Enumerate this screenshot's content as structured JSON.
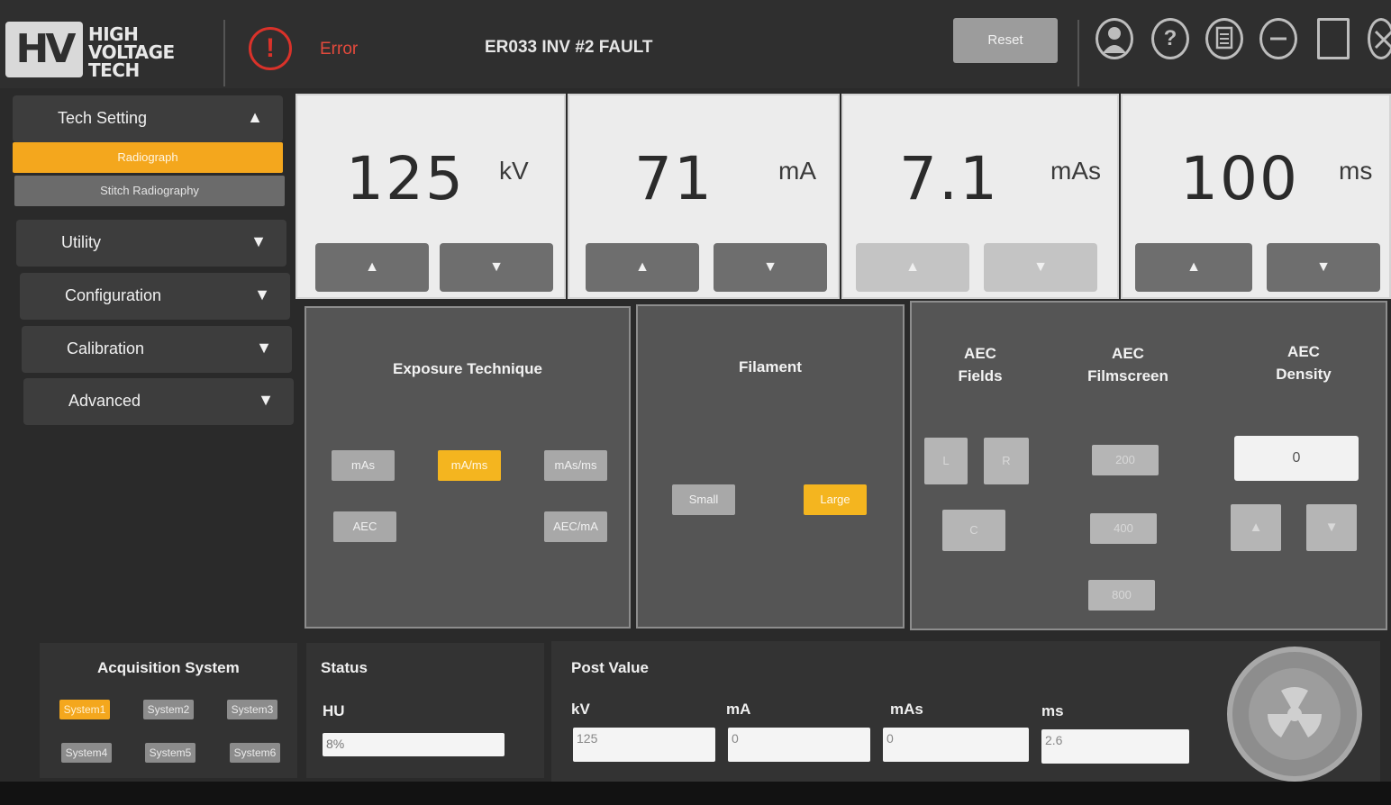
{
  "header": {
    "logo_mark": "HV",
    "logo_lines": [
      "HIGH",
      "VOLTAGE",
      "TECH"
    ],
    "error_icon": "!",
    "error_label": "Error",
    "error_message": "ER033 INV #2 FAULT",
    "reset_label": "Reset",
    "icons": [
      "user-icon",
      "help-icon",
      "document-icon",
      "minimize-icon",
      "maximize-icon",
      "close-icon"
    ]
  },
  "sidebar": {
    "tech_setting": {
      "label": "Tech Setting",
      "arrow": "▲"
    },
    "sub_items": [
      {
        "label": "Radiograph",
        "active": true
      },
      {
        "label": "Stitch Radiography",
        "active": false
      }
    ],
    "menus": [
      {
        "label": "Utility",
        "arrow": "▼"
      },
      {
        "label": "Configuration",
        "arrow": "▼"
      },
      {
        "label": "Calibration",
        "arrow": "▼"
      },
      {
        "label": "Advanced",
        "arrow": "▼"
      }
    ]
  },
  "technique": {
    "kv": {
      "value": "125",
      "unit": "kV"
    },
    "ma": {
      "value": "71",
      "unit": "mA"
    },
    "mas": {
      "value": "7.1",
      "unit": "mAs"
    },
    "ms": {
      "value": "100",
      "unit": "ms"
    },
    "up_glyph": "▲",
    "down_glyph": "▼"
  },
  "exposure": {
    "title": "Exposure Technique",
    "buttons": [
      "mAs",
      "mA/ms",
      "mAs/ms",
      "AEC",
      "AEC/mA"
    ],
    "selected": "mA/ms"
  },
  "filament": {
    "title": "Filament",
    "buttons": [
      "Small",
      "Large"
    ],
    "selected": "Large"
  },
  "aec": {
    "fields_title": "AEC\nFields",
    "filmscreen_title": "AEC\nFilmscreen",
    "density_title": "AEC\nDensity",
    "fields_buttons": [
      "L",
      "R",
      "C"
    ],
    "filmscreen_buttons": [
      "200",
      "400",
      "800"
    ],
    "density_value": "0"
  },
  "acquisition": {
    "title": "Acquisition System",
    "systems": [
      "System1",
      "System2",
      "System3",
      "System4",
      "System5",
      "System6"
    ],
    "selected": "System1"
  },
  "status": {
    "title": "Status",
    "hu_label": "HU",
    "hu_value": "8%"
  },
  "post_value": {
    "title": "Post Value",
    "labels": [
      "kV",
      "mA",
      "mAs",
      "ms"
    ],
    "values": [
      "125",
      "0",
      "0",
      "2.6"
    ]
  },
  "colors": {
    "accent": "#f4a71d",
    "error": "#d9322a",
    "panel": "#555555",
    "card": "#ececec"
  }
}
